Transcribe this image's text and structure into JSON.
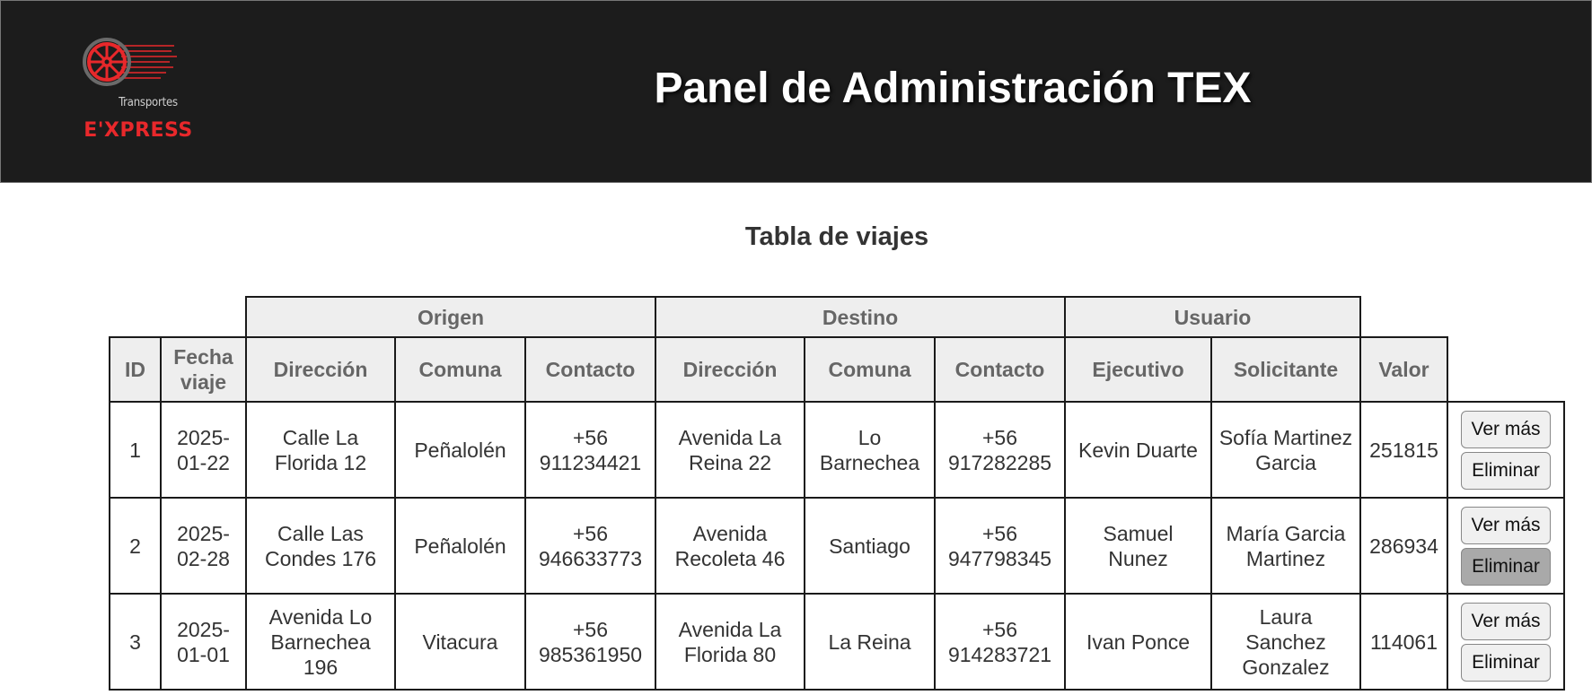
{
  "header": {
    "logo_sub": "Transportes",
    "logo_brand": "E'XPRESS",
    "title": "Panel de Administración TEX"
  },
  "section_title": "Tabla de viajes",
  "table": {
    "groups": {
      "origin": "Origen",
      "destination": "Destino",
      "user": "Usuario"
    },
    "columns": {
      "id": "ID",
      "date": "Fecha viaje",
      "origin_address": "Dirección",
      "origin_commune": "Comuna",
      "origin_contact": "Contacto",
      "dest_address": "Dirección",
      "dest_commune": "Comuna",
      "dest_contact": "Contacto",
      "executive": "Ejecutivo",
      "requester": "Solicitante",
      "value": "Valor"
    },
    "rows": [
      {
        "id": "1",
        "date": "2025-01-22",
        "origin_address": "Calle La Florida 12",
        "origin_commune": "Peñalolén",
        "origin_contact": "+56 911234421",
        "dest_address": "Avenida La Reina 22",
        "dest_commune": "Lo Barnechea",
        "dest_contact": "+56 917282285",
        "executive": "Kevin Duarte",
        "requester": "Sofía Martinez Garcia",
        "value": "251815"
      },
      {
        "id": "2",
        "date": "2025-02-28",
        "origin_address": "Calle Las Condes 176",
        "origin_commune": "Peñalolén",
        "origin_contact": "+56 946633773",
        "dest_address": "Avenida Recoleta 46",
        "dest_commune": "Santiago",
        "dest_contact": "+56 947798345",
        "executive": "Samuel Nunez",
        "requester": "María Garcia Martinez",
        "value": "286934"
      },
      {
        "id": "3",
        "date": "2025-01-01",
        "origin_address": "Avenida Lo Barnechea 196",
        "origin_commune": "Vitacura",
        "origin_contact": "+56 985361950",
        "dest_address": "Avenida La Florida 80",
        "dest_commune": "La Reina",
        "dest_contact": "+56 914283721",
        "executive": "Ivan Ponce",
        "requester": "Laura Sanchez Gonzalez",
        "value": "114061"
      }
    ],
    "actions": {
      "view_more": "Ver más",
      "delete": "Eliminar"
    }
  },
  "colors": {
    "header_bg": "#1c1c1c",
    "brand_red": "#e8282b",
    "header_cell_bg": "#eeeeee",
    "hover_button": "#a9a9a9"
  },
  "icons": {
    "logo": "wheel-icon"
  }
}
